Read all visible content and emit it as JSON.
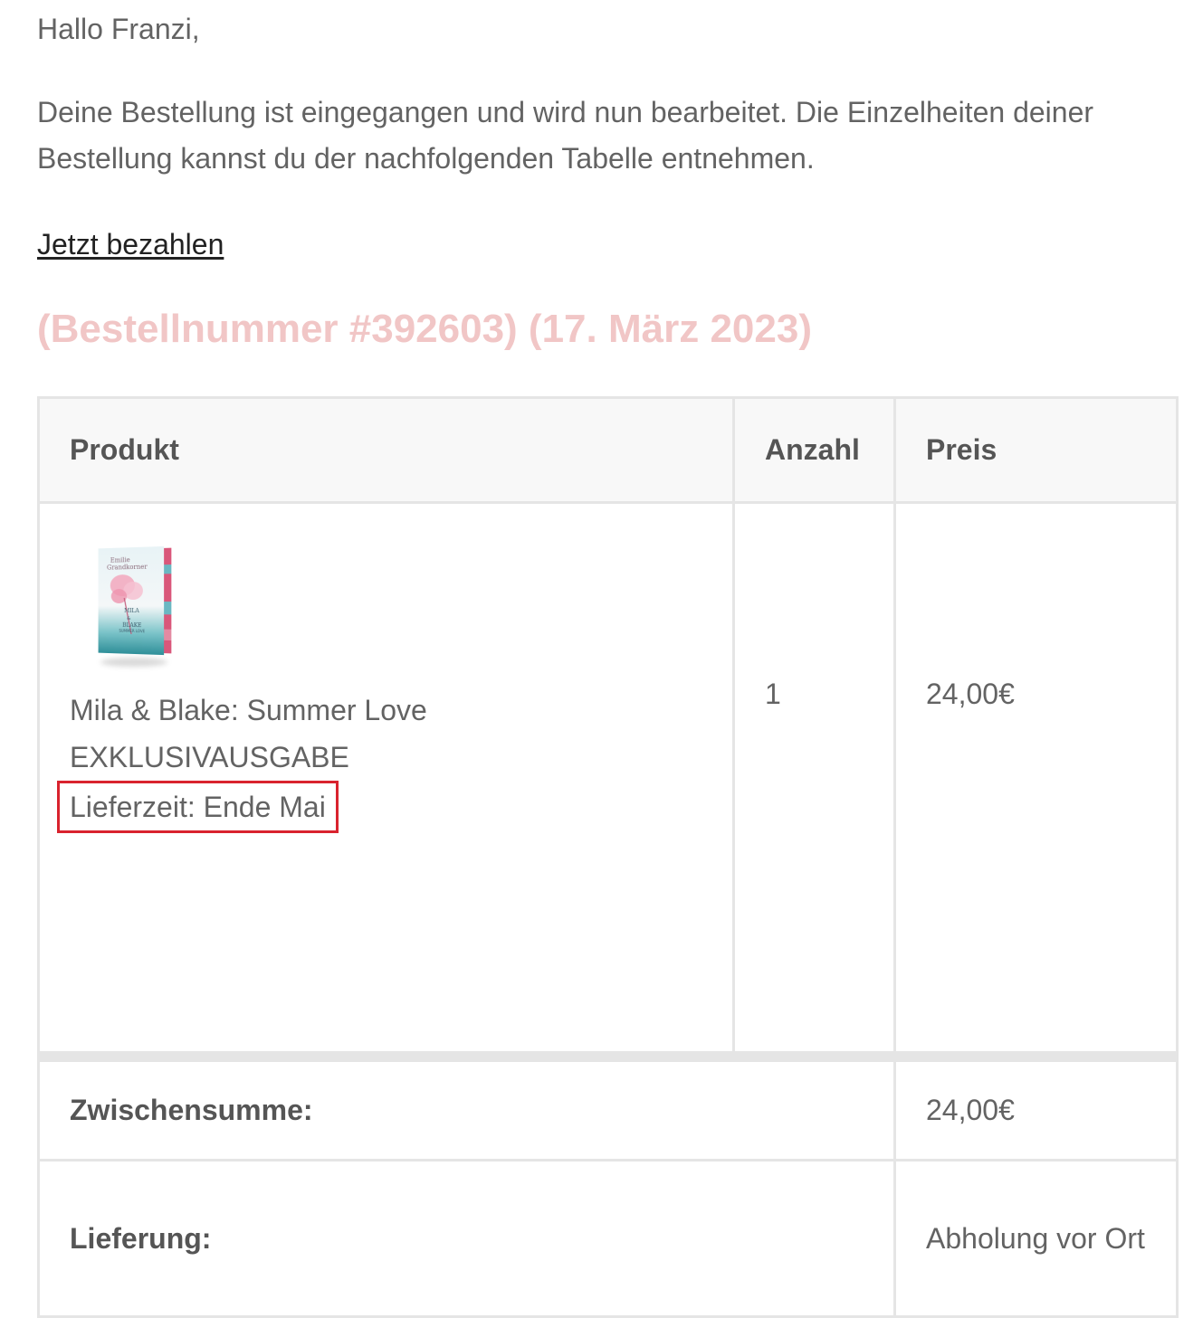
{
  "email": {
    "greeting": "Hallo Franzi,",
    "intro": "Deine Bestellung ist eingegangen und wird nun bearbeitet. Die Einzelheiten deiner Bestellung kannst du der nachfolgenden Tabelle entnehmen.",
    "pay_link": "Jetzt bezahlen",
    "order_heading": "(Bestellnummer #392603) (17. März 2023)",
    "accent_color": "#f1c6c6",
    "highlight_color": "#d9232e"
  },
  "table": {
    "headers": {
      "product": "Produkt",
      "quantity": "Anzahl",
      "price": "Preis"
    },
    "items": [
      {
        "name_line1": "Mila & Blake: Summer Love",
        "name_line2": "EXKLUSIVAUSGABE",
        "delivery_note": "Lieferzeit: Ende Mai",
        "quantity": "1",
        "price": "24,00€",
        "image_icon": "book-cover-icon"
      }
    ],
    "totals": {
      "subtotal_label": "Zwischensumme:",
      "subtotal_value": "24,00€",
      "shipping_label": "Lieferung:",
      "shipping_value": "Abholung vor Ort"
    }
  }
}
